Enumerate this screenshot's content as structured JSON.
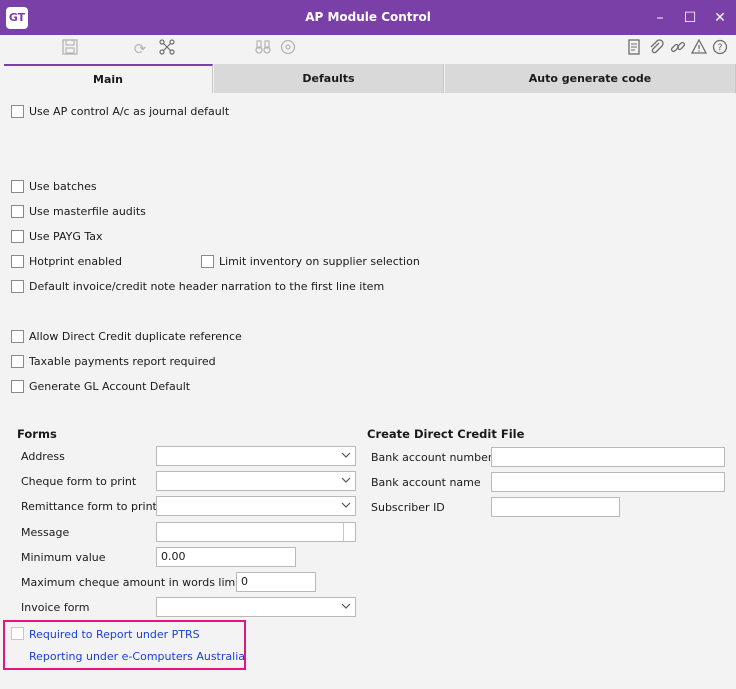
{
  "window": {
    "logo": "GT",
    "title": "AP Module Control",
    "controls": [
      "–",
      "☐",
      "✕"
    ]
  },
  "toolbar": {
    "left_icons": [
      "save-icon",
      "refresh-icon",
      "network-icon",
      "binoculars-icon",
      "compass-icon"
    ],
    "right_icons": [
      "document-icon",
      "attach-icon",
      "link-icon",
      "alert-icon",
      "help-icon"
    ]
  },
  "tabs": [
    "Main",
    "Defaults",
    "Auto generate code"
  ],
  "options": {
    "ap_control_journal": "Use AP control A/c as journal default",
    "use_batches": "Use batches",
    "masterfile_audits": "Use masterfile audits",
    "payg_tax": "Use PAYG Tax",
    "hotprint": "Hotprint enabled",
    "limit_inventory": "Limit inventory on supplier selection",
    "default_narration": "Default invoice/credit note header narration to the first line item",
    "direct_credit_dup": "Allow Direct Credit duplicate reference",
    "taxable_payments": "Taxable payments report required",
    "gl_account_default": "Generate GL Account Default"
  },
  "forms": {
    "heading": "Forms",
    "address": "Address",
    "cheque_form": "Cheque form to print",
    "remittance_form": "Remittance form to print",
    "message": "Message",
    "minimum_value_label": "Minimum value",
    "minimum_value": "0.00",
    "max_cheque_label": "Maximum cheque amount in words limit",
    "max_cheque": "0",
    "invoice_form": "Invoice form"
  },
  "direct_credit": {
    "heading": "Create Direct Credit File",
    "bank_account_number": "Bank account number",
    "bank_account_name": "Bank account name",
    "subscriber_id": "Subscriber ID"
  },
  "ptrs": {
    "required": "Required to Report under PTRS",
    "reporting": "Reporting under e-Computers Australia"
  },
  "colors": {
    "titlebar": "#7b3fa8",
    "highlight": "#e4157f",
    "link": "#1a3fd6"
  }
}
